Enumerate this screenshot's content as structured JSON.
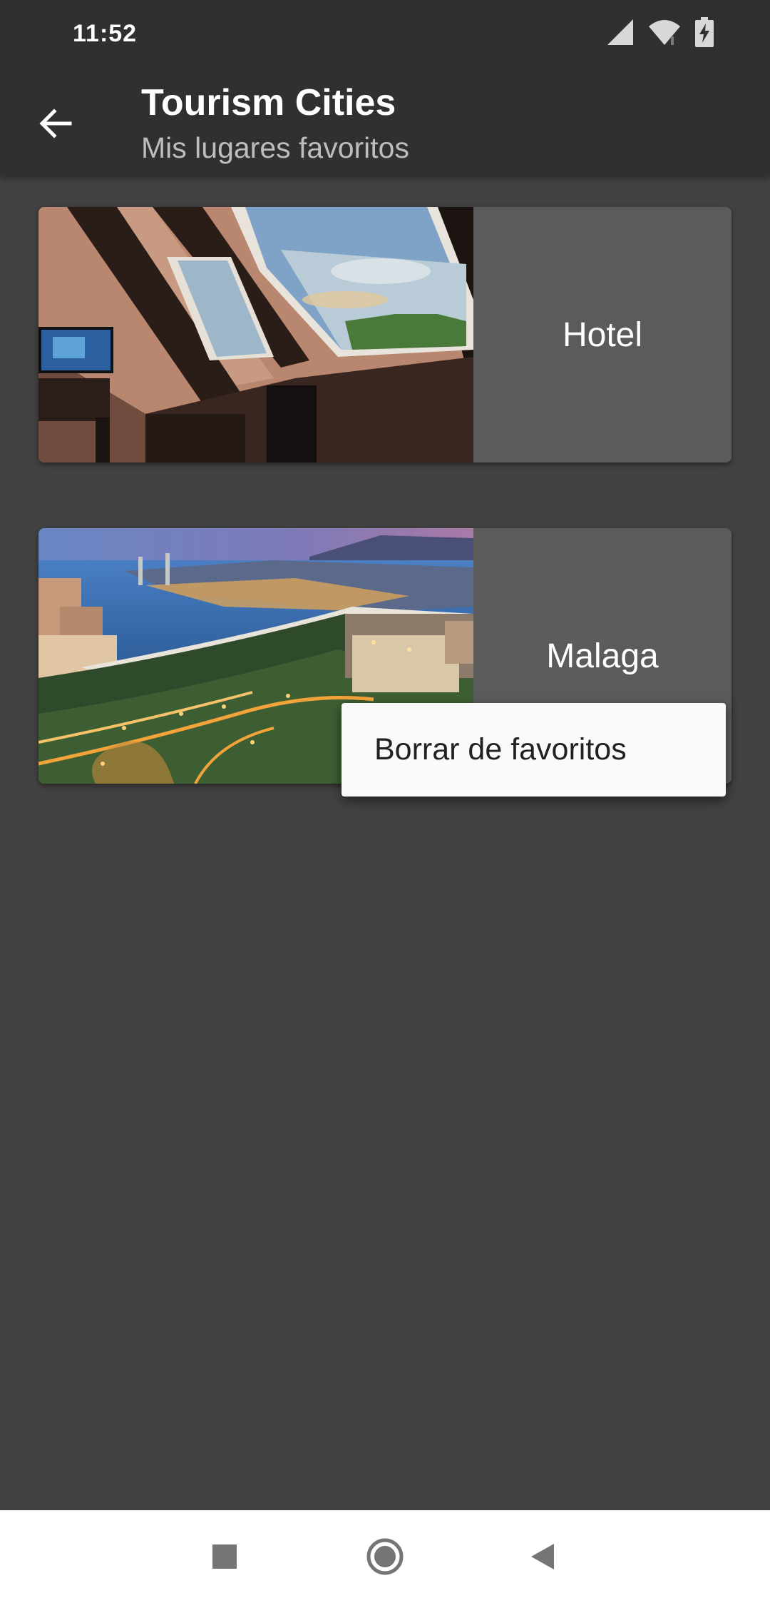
{
  "status_bar": {
    "time": "11:52",
    "icons": [
      "signal-icon",
      "wifi-icon",
      "battery-charging-icon"
    ]
  },
  "app_bar": {
    "title": "Tourism Cities",
    "subtitle": "Mis lugares favoritos",
    "back_icon": "arrow-back-icon"
  },
  "favorites": [
    {
      "label": "Hotel",
      "image": "attic-hotel-room-photo"
    },
    {
      "label": "Malaga",
      "image": "malaga-night-city-photo"
    }
  ],
  "popup_menu": {
    "items": [
      {
        "label": "Borrar de favoritos"
      }
    ]
  },
  "nav_bar": {
    "buttons": [
      "recents-square-icon",
      "home-circle-icon",
      "back-triangle-icon"
    ]
  },
  "colors": {
    "background": "#424242",
    "app_bar": "#303030",
    "card_label_bg": "#5b5b5b",
    "menu_bg": "#fafafa"
  }
}
